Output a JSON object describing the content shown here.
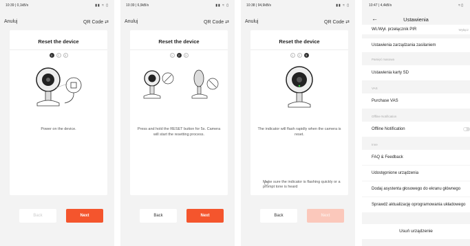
{
  "screens": [
    {
      "status_time": "10:39 | 0,1kB/s",
      "cancel": "Anuluj",
      "qr": "QR Code ⇄",
      "title": "Reset the device",
      "steps": [
        "1",
        "2",
        "3"
      ],
      "active_step": 0,
      "description": "Power on the device.",
      "back": "Back",
      "next": "Next"
    },
    {
      "status_time": "10:39 | 6,9kB/s",
      "cancel": "Anuluj",
      "qr": "QR Code ⇄",
      "title": "Reset the device",
      "steps": [
        "1",
        "2",
        "3"
      ],
      "active_step": 1,
      "description": "Press and hold the RESET button for 5s. Camera will start the resetting process.",
      "back": "Back",
      "next": "Next"
    },
    {
      "status_time": "10:38 | 94,9kB/s",
      "cancel": "Anuluj",
      "qr": "QR Code ⇄",
      "title": "Reset the device",
      "steps": [
        "1",
        "2",
        "3"
      ],
      "active_step": 2,
      "description": "The indicator will flash rapidly when the camera is reset.",
      "hint": "Make sure the indicator is flashing quickly or a prompt tone is heard",
      "back": "Back",
      "next": "Next"
    }
  ],
  "settings": {
    "status_time": "10:47 | 4,4kB/s",
    "title": "Ustawienia",
    "top_row": "Wł./Wył. przełącznik PIR",
    "top_row_value": "Wyłącz",
    "power_row": "Ustawienia zarządzania zasilaniem",
    "section_storage": "Pamięć masowa",
    "sd_row": "Ustawienia karty SD",
    "section_vas": "VAS",
    "vas_row": "Purchase VAS",
    "section_offline": "Offline Notification",
    "offline_row": "Offline Notification",
    "section_inne": "Inne",
    "faq_row": "FAQ & Feedback",
    "shared_row": "Udostępnione urządzenia",
    "assistant_row": "Dodaj asystenta głosowego do ekranu głównego",
    "firmware_row": "Sprawdź aktualizację oprogramowania układowego",
    "remove": "Usuń urządzenie"
  },
  "colors": {
    "accent": "#f4552d",
    "accent_disabled": "#fbc8bb"
  }
}
